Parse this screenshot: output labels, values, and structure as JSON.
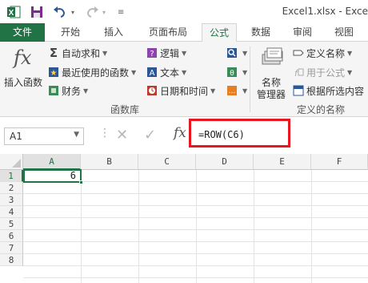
{
  "window": {
    "title": "Excel1.xlsx - Exce"
  },
  "tabs": [
    "文件",
    "开始",
    "插入",
    "页面布局",
    "公式",
    "数据",
    "审阅",
    "视图"
  ],
  "active_tab": "公式",
  "ribbon": {
    "insert_function": {
      "icon": "fx",
      "label": "插入函数"
    },
    "function_library": {
      "items": [
        "自动求和",
        "最近使用的函数",
        "财务",
        "逻辑",
        "文本",
        "日期和时间"
      ],
      "group_label": "函数库"
    },
    "name_manager": {
      "label_line1": "名称",
      "label_line2": "管理器"
    },
    "defined_names": {
      "items": [
        "定义名称",
        "用于公式",
        "根据所选内容"
      ],
      "group_label": "定义的名称"
    }
  },
  "formula_bar": {
    "name_box": "A1",
    "fx": "fx",
    "formula": "=ROW(C6)"
  },
  "grid": {
    "columns": [
      "A",
      "B",
      "C",
      "D",
      "E",
      "F"
    ],
    "rows": [
      "1",
      "2",
      "3",
      "4",
      "5",
      "6",
      "7",
      "8"
    ],
    "cell_A1": "6"
  },
  "colors": {
    "brand_green": "#217346",
    "highlight_red": "#e8161f"
  }
}
